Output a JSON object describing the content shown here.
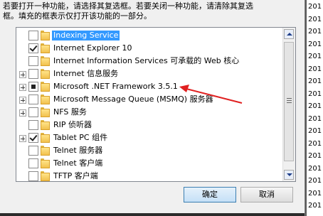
{
  "description": {
    "line1": "若要打开一种功能，请选择其复选框。若要关闭一种功能，请清除其复选",
    "line2": "框。填充的框表示仅打开该功能的一部分。"
  },
  "features": [
    {
      "label": "Indexing Service",
      "state": "unchecked",
      "expandable": false,
      "selected": true
    },
    {
      "label": "Internet Explorer 10",
      "state": "checked",
      "expandable": false,
      "selected": false
    },
    {
      "label": "Internet Information Services 可承载的 Web 核心",
      "state": "unchecked",
      "expandable": false,
      "selected": false
    },
    {
      "label": "Internet 信息服务",
      "state": "unchecked",
      "expandable": true,
      "selected": false
    },
    {
      "label": "Microsoft .NET Framework 3.5.1",
      "state": "partial",
      "expandable": true,
      "selected": false
    },
    {
      "label": "Microsoft Message Queue (MSMQ) 服务器",
      "state": "unchecked",
      "expandable": true,
      "selected": false
    },
    {
      "label": "NFS 服务",
      "state": "unchecked",
      "expandable": true,
      "selected": false
    },
    {
      "label": "RIP 侦听器",
      "state": "unchecked",
      "expandable": false,
      "selected": false
    },
    {
      "label": "Tablet PC 组件",
      "state": "checked",
      "expandable": true,
      "selected": false
    },
    {
      "label": "Telnet 服务器",
      "state": "unchecked",
      "expandable": false,
      "selected": false
    },
    {
      "label": "Telnet 客户端",
      "state": "unchecked",
      "expandable": false,
      "selected": false
    },
    {
      "label": "TFTP 客户端",
      "state": "unchecked",
      "expandable": false,
      "selected": false
    }
  ],
  "buttons": {
    "ok": "确定",
    "cancel": "取消"
  },
  "background_strip": [
    "201",
    "201",
    "201",
    "201",
    "201",
    "201",
    "201",
    "201",
    "201",
    "201",
    "201",
    "201",
    "201",
    "201",
    "201",
    "201",
    "201"
  ],
  "colors": {
    "selection": "#3399ff",
    "annotation_arrow": "#e02020",
    "primary_button_border": "#3c7fb1"
  }
}
